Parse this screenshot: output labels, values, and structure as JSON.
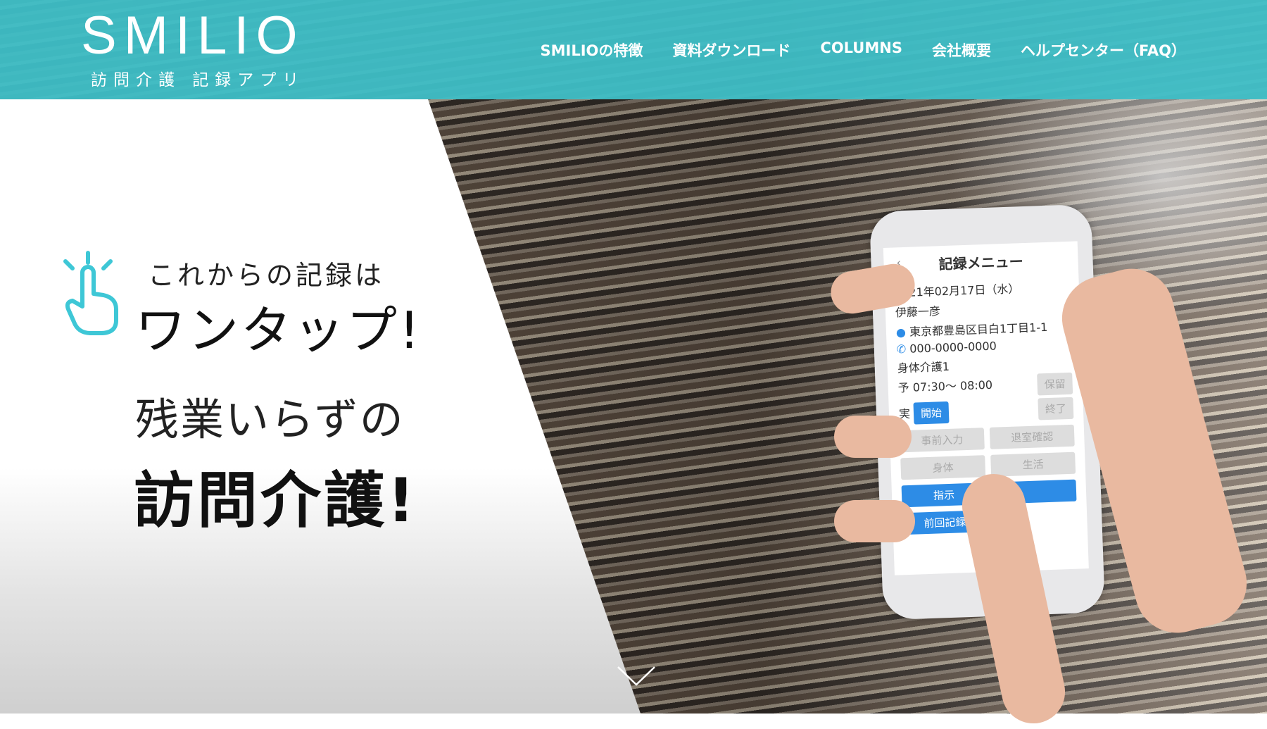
{
  "header": {
    "logo": "SMILIO",
    "logo_sub": "訪問介護 記録アプリ",
    "nav": [
      "SMILIOの特徴",
      "資料ダウンロード",
      "COLUMNS",
      "会社概要",
      "ヘルプセンター（FAQ）"
    ]
  },
  "hero": {
    "line1": "これからの記録は",
    "line2": "ワンタップ!",
    "line3": "残業いらずの",
    "line4": "訪問介護!",
    "accent": "#3ec7d6"
  },
  "phone": {
    "title": "記録メニュー",
    "date": "2021年02月17日（水）",
    "name": "伊藤一彦",
    "address": "東京都豊島区目白1丁目1-1",
    "phone": "000-0000-0000",
    "service": "身体介護1",
    "schedule": "予 07:30〜  08:00",
    "actual_label": "実",
    "buttons": {
      "hold": "保留",
      "start": "開始",
      "end": "終了",
      "pre_input": "事前入力",
      "room_check": "退室確認",
      "body": "身体",
      "life": "生活",
      "instruction": "指示",
      "previous": "前回記録"
    }
  }
}
